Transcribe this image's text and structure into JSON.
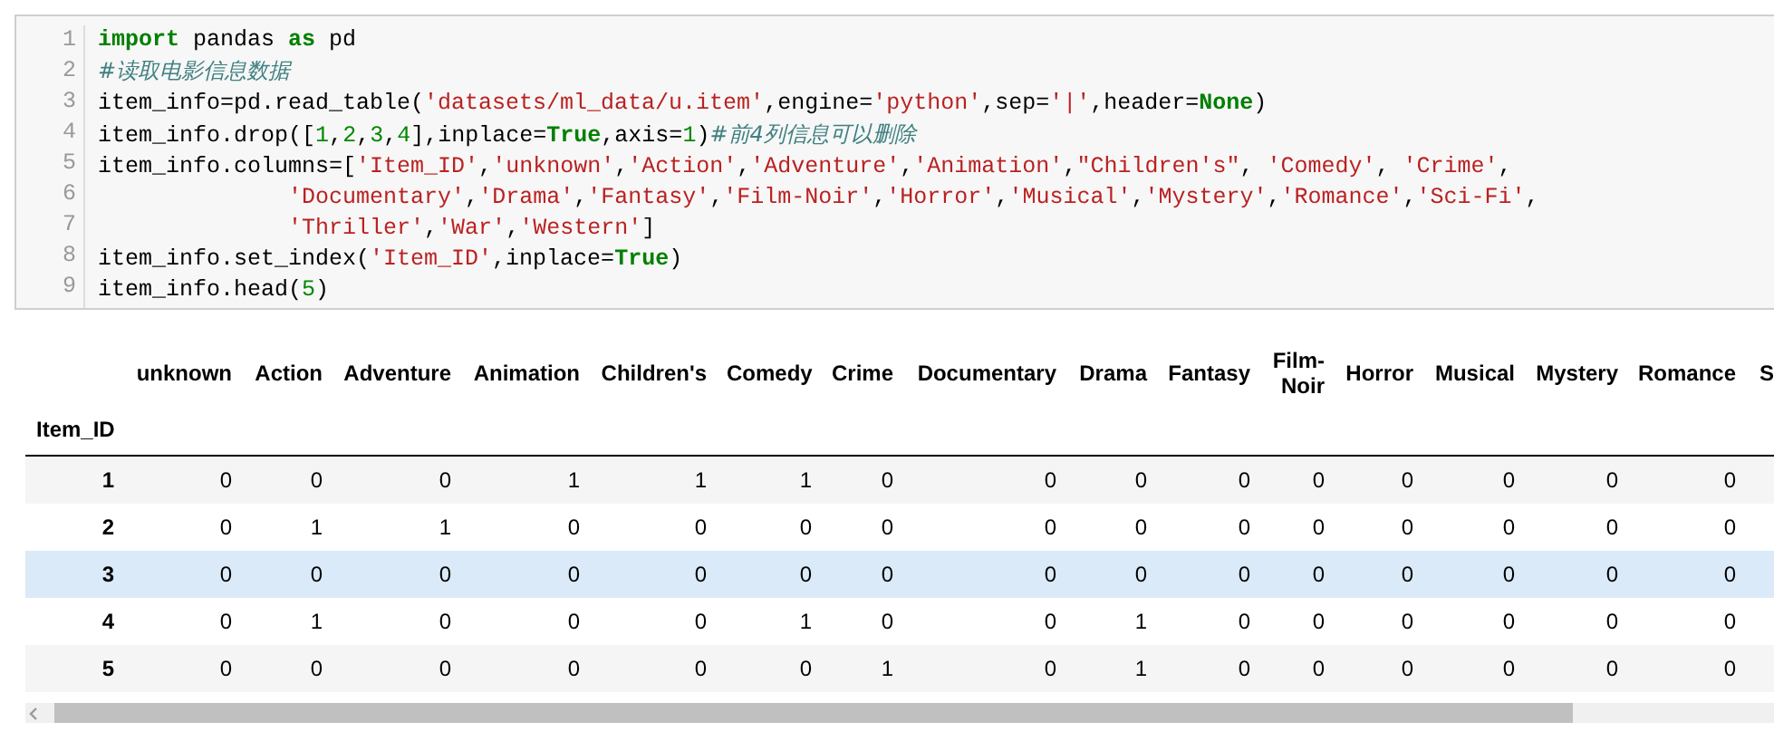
{
  "code_cell": {
    "lines": [
      {
        "number": "1",
        "tokens": [
          {
            "kind": "kw",
            "text": "import"
          },
          {
            "kind": "plain",
            "text": " pandas "
          },
          {
            "kind": "kw",
            "text": "as"
          },
          {
            "kind": "plain",
            "text": " pd"
          }
        ]
      },
      {
        "number": "2",
        "tokens": [
          {
            "kind": "cmt",
            "text": "#读取电影信息数据"
          }
        ]
      },
      {
        "number": "3",
        "tokens": [
          {
            "kind": "plain",
            "text": "item_info=pd.read_table("
          },
          {
            "kind": "str",
            "text": "'datasets/ml_data/u.item'"
          },
          {
            "kind": "plain",
            "text": ",engine="
          },
          {
            "kind": "str",
            "text": "'python'"
          },
          {
            "kind": "plain",
            "text": ",sep="
          },
          {
            "kind": "str",
            "text": "'|'"
          },
          {
            "kind": "plain",
            "text": ",header="
          },
          {
            "kind": "kw",
            "text": "None"
          },
          {
            "kind": "plain",
            "text": ")"
          }
        ]
      },
      {
        "number": "4",
        "tokens": [
          {
            "kind": "plain",
            "text": "item_info.drop(["
          },
          {
            "kind": "num",
            "text": "1"
          },
          {
            "kind": "plain",
            "text": ","
          },
          {
            "kind": "num",
            "text": "2"
          },
          {
            "kind": "plain",
            "text": ","
          },
          {
            "kind": "num",
            "text": "3"
          },
          {
            "kind": "plain",
            "text": ","
          },
          {
            "kind": "num",
            "text": "4"
          },
          {
            "kind": "plain",
            "text": "],inplace="
          },
          {
            "kind": "kw",
            "text": "True"
          },
          {
            "kind": "plain",
            "text": ",axis="
          },
          {
            "kind": "num",
            "text": "1"
          },
          {
            "kind": "plain",
            "text": ")"
          },
          {
            "kind": "cmt",
            "text": "#前4列信息可以删除"
          }
        ]
      },
      {
        "number": "5",
        "tokens": [
          {
            "kind": "plain",
            "text": "item_info.columns=["
          },
          {
            "kind": "str",
            "text": "'Item_ID'"
          },
          {
            "kind": "plain",
            "text": ","
          },
          {
            "kind": "str",
            "text": "'unknown'"
          },
          {
            "kind": "plain",
            "text": ","
          },
          {
            "kind": "str",
            "text": "'Action'"
          },
          {
            "kind": "plain",
            "text": ","
          },
          {
            "kind": "str",
            "text": "'Adventure'"
          },
          {
            "kind": "plain",
            "text": ","
          },
          {
            "kind": "str",
            "text": "'Animation'"
          },
          {
            "kind": "plain",
            "text": ","
          },
          {
            "kind": "str",
            "text": "\"Children's\""
          },
          {
            "kind": "plain",
            "text": ", "
          },
          {
            "kind": "str",
            "text": "'Comedy'"
          },
          {
            "kind": "plain",
            "text": ", "
          },
          {
            "kind": "str",
            "text": "'Crime'"
          },
          {
            "kind": "plain",
            "text": ","
          }
        ]
      },
      {
        "number": "6",
        "indent": true,
        "tokens": [
          {
            "kind": "str",
            "text": "'Documentary'"
          },
          {
            "kind": "plain",
            "text": ","
          },
          {
            "kind": "str",
            "text": "'Drama'"
          },
          {
            "kind": "plain",
            "text": ","
          },
          {
            "kind": "str",
            "text": "'Fantasy'"
          },
          {
            "kind": "plain",
            "text": ","
          },
          {
            "kind": "str",
            "text": "'Film-Noir'"
          },
          {
            "kind": "plain",
            "text": ","
          },
          {
            "kind": "str",
            "text": "'Horror'"
          },
          {
            "kind": "plain",
            "text": ","
          },
          {
            "kind": "str",
            "text": "'Musical'"
          },
          {
            "kind": "plain",
            "text": ","
          },
          {
            "kind": "str",
            "text": "'Mystery'"
          },
          {
            "kind": "plain",
            "text": ","
          },
          {
            "kind": "str",
            "text": "'Romance'"
          },
          {
            "kind": "plain",
            "text": ","
          },
          {
            "kind": "str",
            "text": "'Sci-Fi'"
          },
          {
            "kind": "plain",
            "text": ","
          }
        ]
      },
      {
        "number": "7",
        "indent": true,
        "tokens": [
          {
            "kind": "str",
            "text": "'Thriller'"
          },
          {
            "kind": "plain",
            "text": ","
          },
          {
            "kind": "str",
            "text": "'War'"
          },
          {
            "kind": "plain",
            "text": ","
          },
          {
            "kind": "str",
            "text": "'Western'"
          },
          {
            "kind": "plain",
            "text": "]"
          }
        ]
      },
      {
        "number": "8",
        "tokens": [
          {
            "kind": "plain",
            "text": "item_info.set_index("
          },
          {
            "kind": "str",
            "text": "'Item_ID'"
          },
          {
            "kind": "plain",
            "text": ",inplace="
          },
          {
            "kind": "kw",
            "text": "True"
          },
          {
            "kind": "plain",
            "text": ")"
          }
        ]
      },
      {
        "number": "9",
        "tokens": [
          {
            "kind": "plain",
            "text": "item_info.head("
          },
          {
            "kind": "num",
            "text": "5"
          },
          {
            "kind": "plain",
            "text": ")"
          }
        ]
      }
    ]
  },
  "table": {
    "index_name": "Item_ID",
    "columns": [
      "unknown",
      "Action",
      "Adventure",
      "Animation",
      "Children's",
      "Comedy",
      "Crime",
      "Documentary",
      "Drama",
      "Fantasy",
      "Film-Noir",
      "Horror",
      "Musical",
      "Mystery",
      "Romance",
      "S"
    ],
    "rows": [
      {
        "index": "1",
        "highlighted": false,
        "values": [
          "0",
          "0",
          "0",
          "1",
          "1",
          "1",
          "0",
          "0",
          "0",
          "0",
          "0",
          "0",
          "0",
          "0",
          "0"
        ]
      },
      {
        "index": "2",
        "highlighted": false,
        "values": [
          "0",
          "1",
          "1",
          "0",
          "0",
          "0",
          "0",
          "0",
          "0",
          "0",
          "0",
          "0",
          "0",
          "0",
          "0"
        ]
      },
      {
        "index": "3",
        "highlighted": true,
        "values": [
          "0",
          "0",
          "0",
          "0",
          "0",
          "0",
          "0",
          "0",
          "0",
          "0",
          "0",
          "0",
          "0",
          "0",
          "0"
        ]
      },
      {
        "index": "4",
        "highlighted": false,
        "values": [
          "0",
          "1",
          "0",
          "0",
          "0",
          "1",
          "0",
          "0",
          "1",
          "0",
          "0",
          "0",
          "0",
          "0",
          "0"
        ]
      },
      {
        "index": "5",
        "highlighted": false,
        "values": [
          "0",
          "0",
          "0",
          "0",
          "0",
          "0",
          "1",
          "0",
          "1",
          "0",
          "0",
          "0",
          "0",
          "0",
          "0"
        ]
      }
    ]
  }
}
